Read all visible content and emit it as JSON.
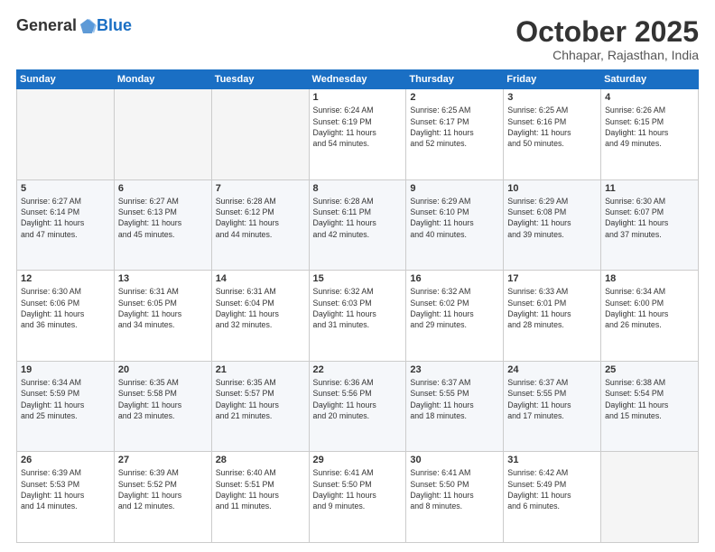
{
  "header": {
    "logo_general": "General",
    "logo_blue": "Blue",
    "month_title": "October 2025",
    "location": "Chhapar, Rajasthan, India"
  },
  "weekdays": [
    "Sunday",
    "Monday",
    "Tuesday",
    "Wednesday",
    "Thursday",
    "Friday",
    "Saturday"
  ],
  "weeks": [
    [
      {
        "num": "",
        "info": ""
      },
      {
        "num": "",
        "info": ""
      },
      {
        "num": "",
        "info": ""
      },
      {
        "num": "1",
        "info": "Sunrise: 6:24 AM\nSunset: 6:19 PM\nDaylight: 11 hours\nand 54 minutes."
      },
      {
        "num": "2",
        "info": "Sunrise: 6:25 AM\nSunset: 6:17 PM\nDaylight: 11 hours\nand 52 minutes."
      },
      {
        "num": "3",
        "info": "Sunrise: 6:25 AM\nSunset: 6:16 PM\nDaylight: 11 hours\nand 50 minutes."
      },
      {
        "num": "4",
        "info": "Sunrise: 6:26 AM\nSunset: 6:15 PM\nDaylight: 11 hours\nand 49 minutes."
      }
    ],
    [
      {
        "num": "5",
        "info": "Sunrise: 6:27 AM\nSunset: 6:14 PM\nDaylight: 11 hours\nand 47 minutes."
      },
      {
        "num": "6",
        "info": "Sunrise: 6:27 AM\nSunset: 6:13 PM\nDaylight: 11 hours\nand 45 minutes."
      },
      {
        "num": "7",
        "info": "Sunrise: 6:28 AM\nSunset: 6:12 PM\nDaylight: 11 hours\nand 44 minutes."
      },
      {
        "num": "8",
        "info": "Sunrise: 6:28 AM\nSunset: 6:11 PM\nDaylight: 11 hours\nand 42 minutes."
      },
      {
        "num": "9",
        "info": "Sunrise: 6:29 AM\nSunset: 6:10 PM\nDaylight: 11 hours\nand 40 minutes."
      },
      {
        "num": "10",
        "info": "Sunrise: 6:29 AM\nSunset: 6:08 PM\nDaylight: 11 hours\nand 39 minutes."
      },
      {
        "num": "11",
        "info": "Sunrise: 6:30 AM\nSunset: 6:07 PM\nDaylight: 11 hours\nand 37 minutes."
      }
    ],
    [
      {
        "num": "12",
        "info": "Sunrise: 6:30 AM\nSunset: 6:06 PM\nDaylight: 11 hours\nand 36 minutes."
      },
      {
        "num": "13",
        "info": "Sunrise: 6:31 AM\nSunset: 6:05 PM\nDaylight: 11 hours\nand 34 minutes."
      },
      {
        "num": "14",
        "info": "Sunrise: 6:31 AM\nSunset: 6:04 PM\nDaylight: 11 hours\nand 32 minutes."
      },
      {
        "num": "15",
        "info": "Sunrise: 6:32 AM\nSunset: 6:03 PM\nDaylight: 11 hours\nand 31 minutes."
      },
      {
        "num": "16",
        "info": "Sunrise: 6:32 AM\nSunset: 6:02 PM\nDaylight: 11 hours\nand 29 minutes."
      },
      {
        "num": "17",
        "info": "Sunrise: 6:33 AM\nSunset: 6:01 PM\nDaylight: 11 hours\nand 28 minutes."
      },
      {
        "num": "18",
        "info": "Sunrise: 6:34 AM\nSunset: 6:00 PM\nDaylight: 11 hours\nand 26 minutes."
      }
    ],
    [
      {
        "num": "19",
        "info": "Sunrise: 6:34 AM\nSunset: 5:59 PM\nDaylight: 11 hours\nand 25 minutes."
      },
      {
        "num": "20",
        "info": "Sunrise: 6:35 AM\nSunset: 5:58 PM\nDaylight: 11 hours\nand 23 minutes."
      },
      {
        "num": "21",
        "info": "Sunrise: 6:35 AM\nSunset: 5:57 PM\nDaylight: 11 hours\nand 21 minutes."
      },
      {
        "num": "22",
        "info": "Sunrise: 6:36 AM\nSunset: 5:56 PM\nDaylight: 11 hours\nand 20 minutes."
      },
      {
        "num": "23",
        "info": "Sunrise: 6:37 AM\nSunset: 5:55 PM\nDaylight: 11 hours\nand 18 minutes."
      },
      {
        "num": "24",
        "info": "Sunrise: 6:37 AM\nSunset: 5:55 PM\nDaylight: 11 hours\nand 17 minutes."
      },
      {
        "num": "25",
        "info": "Sunrise: 6:38 AM\nSunset: 5:54 PM\nDaylight: 11 hours\nand 15 minutes."
      }
    ],
    [
      {
        "num": "26",
        "info": "Sunrise: 6:39 AM\nSunset: 5:53 PM\nDaylight: 11 hours\nand 14 minutes."
      },
      {
        "num": "27",
        "info": "Sunrise: 6:39 AM\nSunset: 5:52 PM\nDaylight: 11 hours\nand 12 minutes."
      },
      {
        "num": "28",
        "info": "Sunrise: 6:40 AM\nSunset: 5:51 PM\nDaylight: 11 hours\nand 11 minutes."
      },
      {
        "num": "29",
        "info": "Sunrise: 6:41 AM\nSunset: 5:50 PM\nDaylight: 11 hours\nand 9 minutes."
      },
      {
        "num": "30",
        "info": "Sunrise: 6:41 AM\nSunset: 5:50 PM\nDaylight: 11 hours\nand 8 minutes."
      },
      {
        "num": "31",
        "info": "Sunrise: 6:42 AM\nSunset: 5:49 PM\nDaylight: 11 hours\nand 6 minutes."
      },
      {
        "num": "",
        "info": ""
      }
    ]
  ]
}
